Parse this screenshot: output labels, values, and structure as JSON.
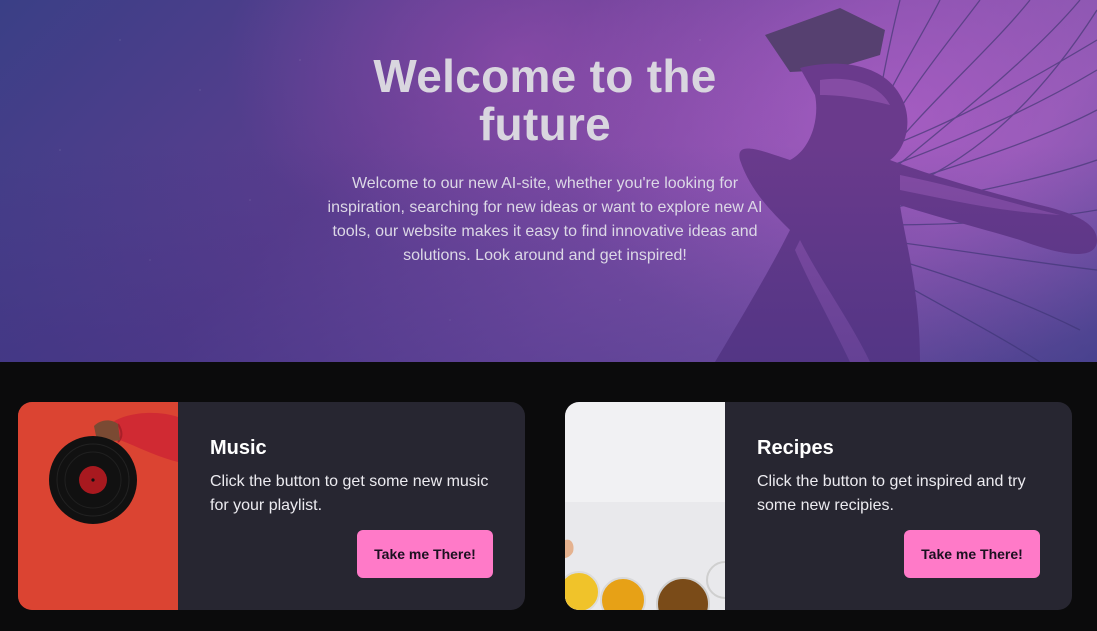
{
  "hero": {
    "title_line1": "Welcome to the",
    "title_line2": "future",
    "text": "Welcome to our new AI-site, whether you're looking for inspiration, searching for new ideas or want to explore new AI tools, our website makes it easy to find innovative ideas and solutions. Look around and get inspired!"
  },
  "cards": [
    {
      "title": "Music",
      "text": "Click the button to get some new music for your playlist.",
      "button_label": "Take me There!"
    },
    {
      "title": "Recipes",
      "text": "Click the button to get inspired and try some new recipies.",
      "button_label": "Take me There!"
    }
  ],
  "colors": {
    "page_background": "#0b0b0c",
    "card_background": "#272631",
    "button_pink": "#ff7ac8",
    "hero_purple": "#7d4da6"
  }
}
